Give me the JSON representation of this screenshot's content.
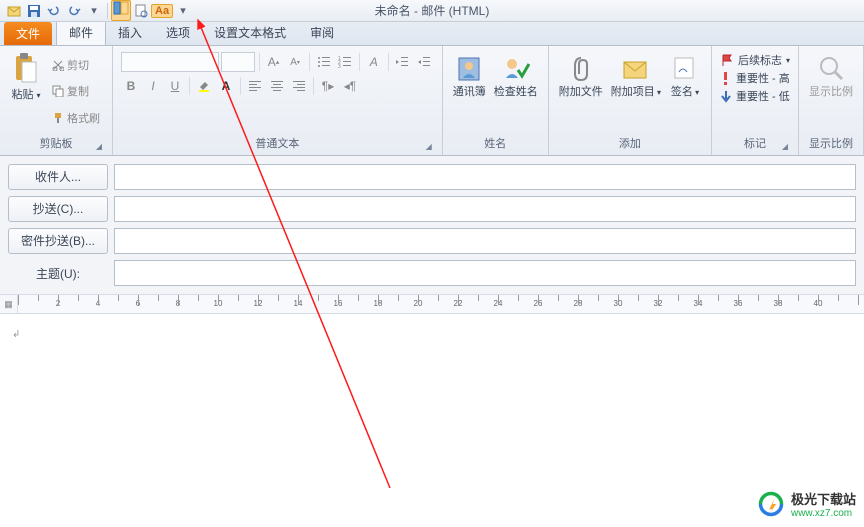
{
  "window": {
    "title": "未命名 - 邮件 (HTML)"
  },
  "tabs": {
    "file": "文件",
    "mail": "邮件",
    "insert": "插入",
    "options": "选项",
    "format": "设置文本格式",
    "review": "审阅"
  },
  "clipboard": {
    "paste": "粘贴",
    "cut": "剪切",
    "copy": "复制",
    "format_painter": "格式刷",
    "group": "剪贴板"
  },
  "font": {
    "bold": "B",
    "italic": "I",
    "underline": "U",
    "group": "普通文本"
  },
  "names": {
    "addressbook": "通讯簿",
    "check": "检查姓名",
    "group": "姓名"
  },
  "include": {
    "attach_file": "附加文件",
    "attach_item": "附加项目",
    "signature": "签名",
    "group": "添加"
  },
  "tags": {
    "followup": "后续标志",
    "importance_high": "重要性 - 高",
    "importance_low": "重要性 - 低",
    "group": "标记"
  },
  "zoom": {
    "label": "显示比例",
    "group": "显示比例"
  },
  "recipients": {
    "to": "收件人...",
    "cc": "抄送(C)...",
    "bcc": "密件抄送(B)...",
    "subject": "主题(U):"
  },
  "ruler": {
    "numbers": [
      2,
      4,
      6,
      8,
      10,
      12,
      14,
      16,
      18,
      20,
      22,
      24,
      26,
      28,
      30,
      32,
      34,
      36,
      38,
      40
    ]
  },
  "watermark": {
    "name": "极光下载站",
    "url": "www.xz7.com"
  }
}
